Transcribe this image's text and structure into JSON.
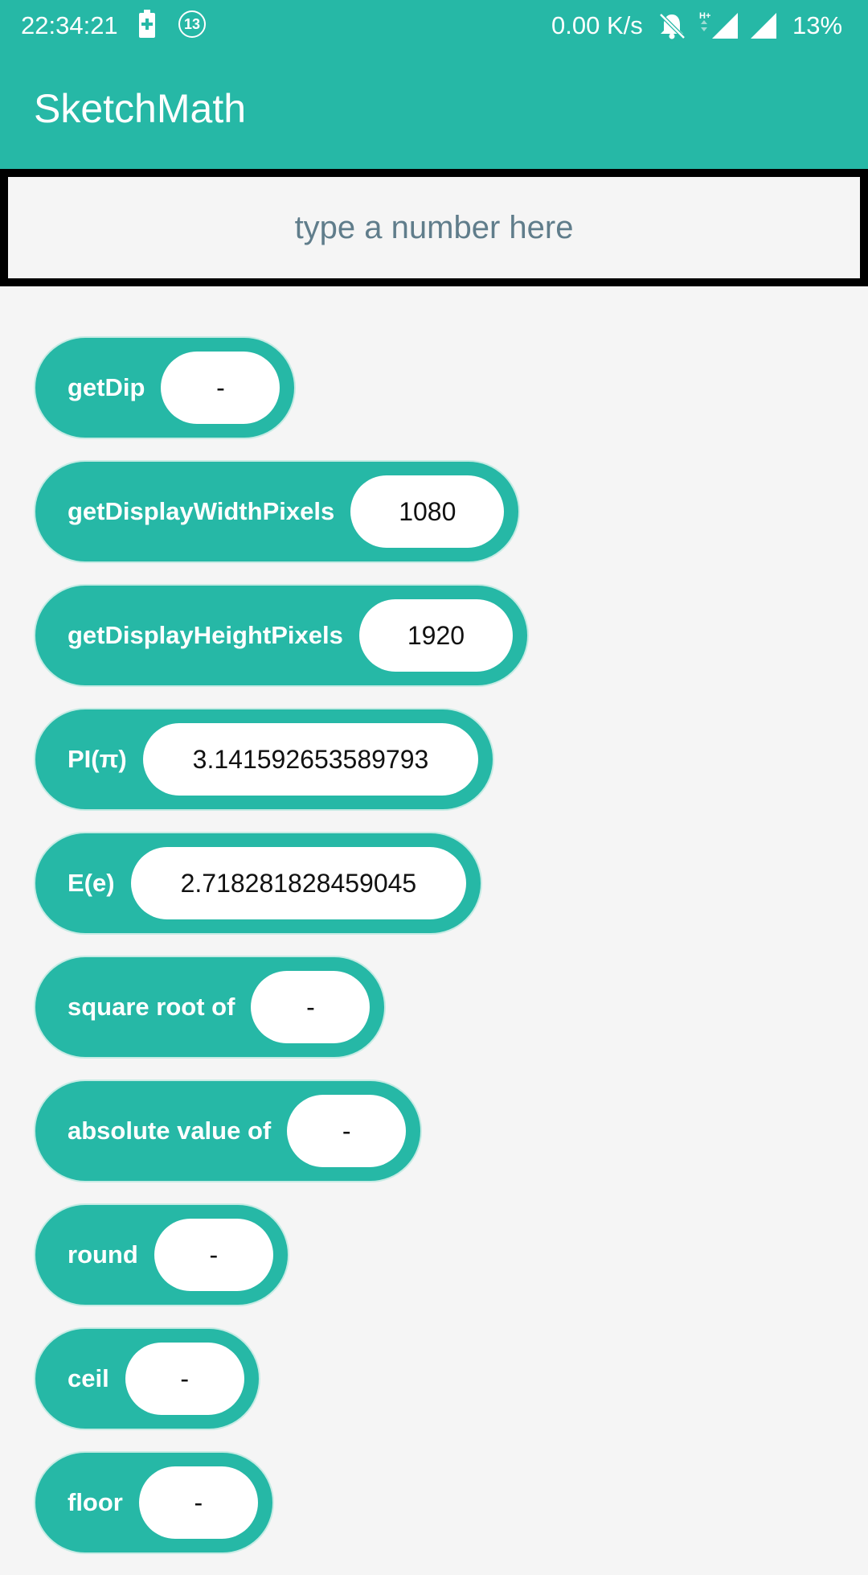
{
  "status_bar": {
    "time": "22:34:21",
    "alarm_badge": "13",
    "net_speed": "0.00 K/s",
    "battery_percent": "13%"
  },
  "app_bar": {
    "title": "SketchMath"
  },
  "number_input": {
    "placeholder": "type a number here",
    "value": ""
  },
  "functions": [
    {
      "label": "getDip",
      "value": "-"
    },
    {
      "label": "getDisplayWidthPixels",
      "value": "1080"
    },
    {
      "label": "getDisplayHeightPixels",
      "value": "1920"
    },
    {
      "label": "PI(π)",
      "value": "3.141592653589793"
    },
    {
      "label": "E(e)",
      "value": "2.718281828459045"
    },
    {
      "label": "square root of",
      "value": "-"
    },
    {
      "label": "absolute value of",
      "value": "-"
    },
    {
      "label": "round",
      "value": "-"
    },
    {
      "label": "ceil",
      "value": "-"
    },
    {
      "label": "floor",
      "value": "-"
    }
  ],
  "colors": {
    "primary": "#26b8a6",
    "background": "#f5f5f5"
  }
}
